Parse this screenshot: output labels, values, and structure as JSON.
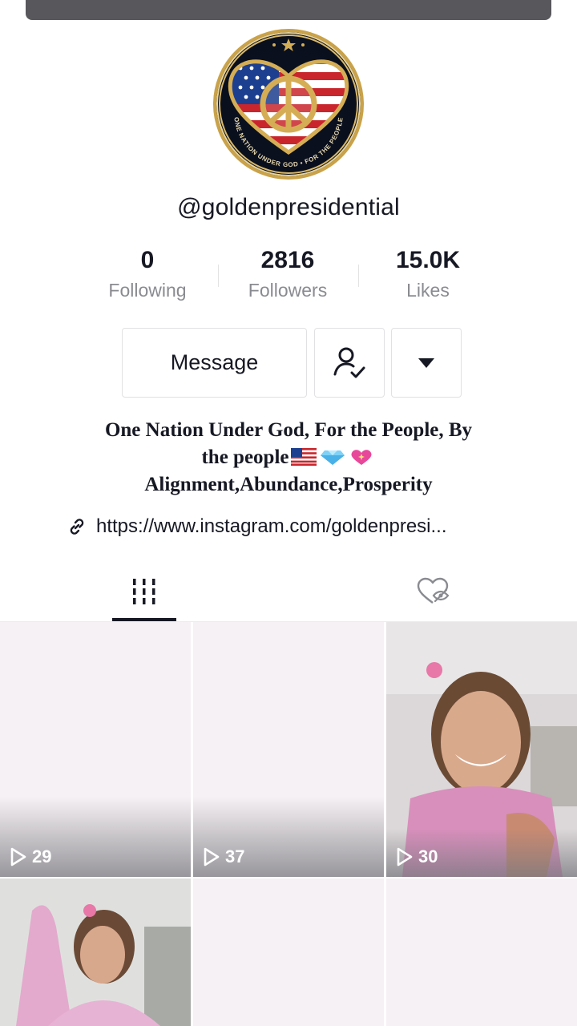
{
  "profile": {
    "username": "@goldenpresidential",
    "avatar_badge_text": "ONE NATION UNDER GOD • FOR THE PEOPLE",
    "stats": {
      "following": {
        "value": "0",
        "label": "Following"
      },
      "followers": {
        "value": "2816",
        "label": "Followers"
      },
      "likes": {
        "value": "15.0K",
        "label": "Likes"
      }
    },
    "buttons": {
      "message": "Message",
      "follow_icon": "person-check-icon",
      "more_icon": "caret-down-icon"
    },
    "bio": {
      "line1": "One Nation Under God, For the People, By",
      "line2_text": "the people",
      "line2_emojis": [
        "🇺🇸",
        "💎",
        "💖"
      ],
      "line3": "Alignment,Abundance,Prosperity"
    },
    "link": "https://www.instagram.com/goldenpresi..."
  },
  "tabs": [
    {
      "name": "videos",
      "icon": "grid-icon",
      "active": true
    },
    {
      "name": "liked",
      "icon": "heart-hidden-icon",
      "active": false
    }
  ],
  "videos": [
    {
      "views": "29"
    },
    {
      "views": "37"
    },
    {
      "views": "30"
    }
  ],
  "colors": {
    "text": "#161823",
    "muted": "#8a8b91",
    "border": "#e1e1e3",
    "gold": "#c9a24a"
  }
}
